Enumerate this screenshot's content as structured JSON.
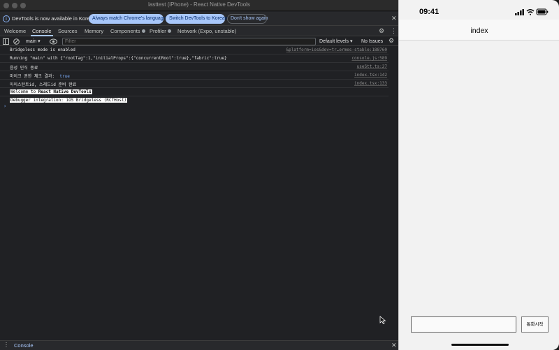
{
  "window": {
    "title": "lasttest (iPhone) - React Native DevTools"
  },
  "infobar": {
    "message": "DevTools is now available in Korean!",
    "match_language_label": "Always match Chrome's language",
    "switch_language_label": "Switch DevTools to Korean",
    "dont_show_label": "Don't show again"
  },
  "tabs": [
    {
      "label": "Welcome"
    },
    {
      "label": "Console"
    },
    {
      "label": "Sources"
    },
    {
      "label": "Memory"
    },
    {
      "label": "Components"
    },
    {
      "label": "Profiler"
    },
    {
      "label": "Network (Expo, unstable)"
    }
  ],
  "toolbar": {
    "context": "main",
    "filter_placeholder": "Filter",
    "levels": "Default levels",
    "issues": "No Issues"
  },
  "console": {
    "rows": [
      {
        "message": "Bridgeless mode is enabled",
        "source": "&platform=ios&dev=tr…ermes-stable:188760"
      },
      {
        "message": "Running \"main\" with {\"rootTag\":1,\"initialProps\":{\"concurrentRoot\":true},\"fabric\":true}",
        "source": "console.js:589"
      },
      {
        "message": "음성 인식 종료",
        "source": "useStt.ts:27"
      },
      {
        "message": "마이크 권한 체크 결과:",
        "value": "true",
        "source": "index.tsx:142"
      },
      {
        "message": "아이스턴트id, 스레드id 준비 완료",
        "source": "index.tsx:133"
      }
    ],
    "welcome_prefix": "Welcome to ",
    "welcome_bold": "React Native DevTools",
    "debugger_line": "Debugger integration: iOS Bridgeless (RCTHost)",
    "prompt": "›"
  },
  "drawer": {
    "tab": "Console"
  },
  "phone": {
    "time": "09:41",
    "nav_title": "index",
    "input_value": "",
    "button_label": "통화시작"
  },
  "colors": {
    "accent": "#a8c7fa",
    "console_bg": "#202124",
    "phone_bg": "#f2f2f2"
  }
}
